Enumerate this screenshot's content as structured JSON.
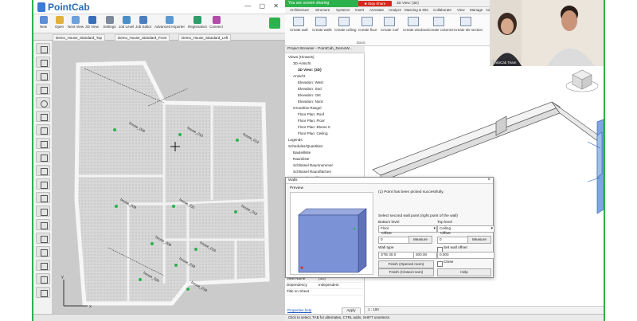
{
  "pointcab": {
    "app_name": "PointCab",
    "ribbon": [
      "New",
      "Open",
      "Next View",
      "3D View",
      "Settings",
      "Job Level",
      "Job Editor",
      "Advanced Importer",
      "Registration",
      "Connect"
    ],
    "tabs": [
      "Demo_House_Standard_Top",
      "Demo_House_Standard_Front",
      "Demo_House_Standard_Left"
    ],
    "rooms": [
      "house_006",
      "house_010",
      "house_014",
      "house_009",
      "house_011",
      "house_012",
      "house_016",
      "house_018",
      "house_020",
      "house_019",
      "house_008"
    ],
    "status": ""
  },
  "revit": {
    "share_banner": "You are screen sharing",
    "stop_share": "■ Stop Share",
    "doc_title": "3D View: {3D}",
    "menu": [
      "Architecture",
      "Structure",
      "Systems",
      "Insert",
      "Annotate",
      "Analyze",
      "Massing & Site",
      "Collaborate",
      "View",
      "Manage",
      "Add-Ins"
    ],
    "ribbon_buttons": [
      "Create wall",
      "Create walls",
      "Create ceiling",
      "Create floor",
      "Create roof",
      "Create windows",
      "Create columns",
      "Create 3D section",
      "Options",
      "About"
    ],
    "ribbon_groups": [
      "Basic",
      "Options",
      "About"
    ],
    "project_browser": {
      "title": "Project Browser - PointCab_DemoW...",
      "items": [
        {
          "label": "Views (Hinweis)",
          "indent": 0,
          "bold": false
        },
        {
          "label": "3D-Ansicht",
          "indent": 1,
          "bold": false
        },
        {
          "label": "3D View: {3D}",
          "indent": 2,
          "bold": true
        },
        {
          "label": "Ansicht",
          "indent": 1,
          "bold": false
        },
        {
          "label": "Elevation: West",
          "indent": 2,
          "bold": false
        },
        {
          "label": "Elevation: Süd",
          "indent": 2,
          "bold": false
        },
        {
          "label": "Elevation: Ost",
          "indent": 2,
          "bold": false
        },
        {
          "label": "Elevation: Nord",
          "indent": 2,
          "bold": false
        },
        {
          "label": "Grundriss Rasgel",
          "indent": 1,
          "bold": false
        },
        {
          "label": "Floor Plan: Roof",
          "indent": 2,
          "bold": false
        },
        {
          "label": "Floor Plan: Floor",
          "indent": 2,
          "bold": false
        },
        {
          "label": "Floor Plan: Ebene 0",
          "indent": 2,
          "bold": false
        },
        {
          "label": "Floor Plan: Ceiling",
          "indent": 2,
          "bold": false
        },
        {
          "label": "Legends",
          "indent": 0,
          "bold": false
        },
        {
          "label": "Schedules/Quantities",
          "indent": 0,
          "bold": false
        },
        {
          "label": "Bauteilliste",
          "indent": 1,
          "bold": false
        },
        {
          "label": "Raumliste",
          "indent": 1,
          "bold": false
        },
        {
          "label": "Schlüssel Raumnummer",
          "indent": 1,
          "bold": false
        },
        {
          "label": "Schlüssel Raumflächen",
          "indent": 1,
          "bold": false
        },
        {
          "label": "Treppenbauteilliste",
          "indent": 1,
          "bold": false
        },
        {
          "label": "Türliste",
          "indent": 1,
          "bold": false
        }
      ]
    },
    "properties": [
      {
        "key": "View Template",
        "value": "<None>"
      },
      {
        "key": "View Name",
        "value": "{3D}"
      },
      {
        "key": "Dependency",
        "value": "Independent"
      },
      {
        "key": "Title on Sheet",
        "value": ""
      }
    ],
    "properties_help": "Properties help",
    "apply": "Apply",
    "scale": "1 : 100",
    "status": "Click to select, TAB for alternates, CTRL adds, SHIFT unselects."
  },
  "webcam": {
    "label": "PhiloCab Team"
  },
  "dialog": {
    "title": "Walls",
    "close": "×",
    "preview_label": "Preview",
    "message": "(1) Point has been picked successfully.",
    "instruction": "Select second wall point (right point of the wall)",
    "bottom_level_label": "Bottom level",
    "top_level_label": "Top level",
    "bottom_level": "Floor",
    "top_level": "Ceiling",
    "offset_label": "Offset",
    "bottom_offset": "0",
    "top_offset": "0",
    "measure": "Measure",
    "wall_type_label": "Wall type",
    "wall_type": "STB 30.0",
    "wall_type_thickness": "300.00",
    "set_wall_offset": "Set wall offset",
    "wall_offset_value": "0.000",
    "finish_opened": "Finish (Opened room)",
    "finish_closed": "Finish (Closed room)",
    "close_btn": "Close",
    "help_btn": "Help"
  },
  "colors": {
    "accent_green": "#2bb24c",
    "stop_red": "#d9261c",
    "wall_blue": "#7b93d6"
  }
}
